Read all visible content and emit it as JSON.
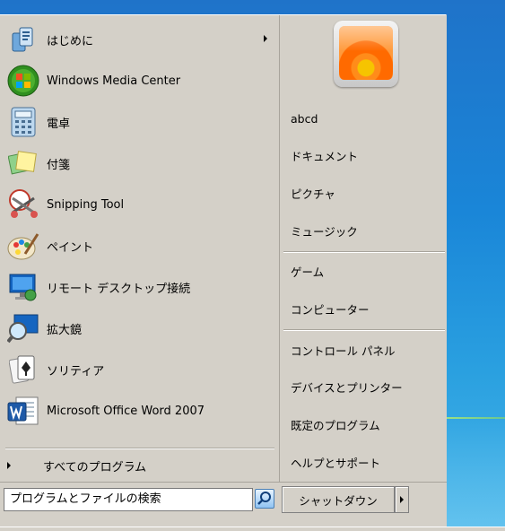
{
  "left_items": [
    {
      "label": "はじめに",
      "icon": "getting-started-icon",
      "has_submenu": true
    },
    {
      "label": "Windows Media Center",
      "icon": "windows-media-center-icon",
      "has_submenu": false
    },
    {
      "label": "電卓",
      "icon": "calculator-icon",
      "has_submenu": false
    },
    {
      "label": "付箋",
      "icon": "sticky-notes-icon",
      "has_submenu": false
    },
    {
      "label": "Snipping Tool",
      "icon": "snipping-tool-icon",
      "has_submenu": false
    },
    {
      "label": "ペイント",
      "icon": "paint-icon",
      "has_submenu": false
    },
    {
      "label": "リモート デスクトップ接続",
      "icon": "remote-desktop-icon",
      "has_submenu": false
    },
    {
      "label": "拡大鏡",
      "icon": "magnifier-icon",
      "has_submenu": false
    },
    {
      "label": "ソリティア",
      "icon": "solitaire-icon",
      "has_submenu": false
    },
    {
      "label": "Microsoft Office Word 2007",
      "icon": "word-icon",
      "has_submenu": false
    }
  ],
  "all_programs_label": "すべてのプログラム",
  "right_items": [
    {
      "label": "abcd"
    },
    {
      "label": "ドキュメント"
    },
    {
      "label": "ピクチャ"
    },
    {
      "label": "ミュージック"
    },
    {
      "label": "ゲーム"
    },
    {
      "label": "コンピューター"
    },
    {
      "label": "コントロール パネル"
    },
    {
      "label": "デバイスとプリンター"
    },
    {
      "label": "既定のプログラム"
    },
    {
      "label": "ヘルプとサポート"
    }
  ],
  "search": {
    "placeholder": "プログラムとファイルの検索",
    "icon": "search-icon"
  },
  "shutdown": {
    "label": "シャットダウン"
  },
  "colors": {
    "menu_bg": "#d4d0c8",
    "desktop": "#1a86d8"
  }
}
